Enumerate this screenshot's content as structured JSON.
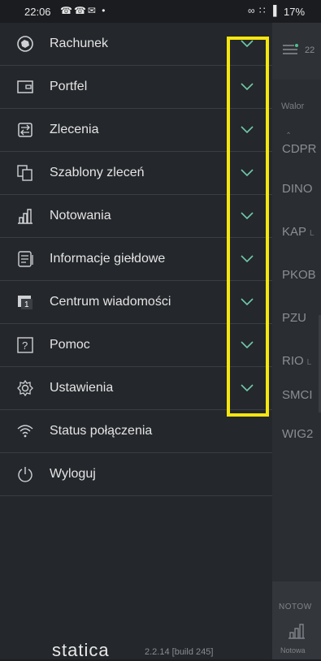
{
  "status_bar": {
    "time": "22:06",
    "battery": "17%"
  },
  "menu": [
    {
      "label": "Rachunek",
      "icon": "account-icon",
      "expandable": true
    },
    {
      "label": "Portfel",
      "icon": "wallet-icon",
      "expandable": true
    },
    {
      "label": "Zlecenia",
      "icon": "orders-icon",
      "expandable": true
    },
    {
      "label": "Szablony zleceń",
      "icon": "templates-icon",
      "expandable": true
    },
    {
      "label": "Notowania",
      "icon": "quotes-icon",
      "expandable": true
    },
    {
      "label": "Informacje giełdowe",
      "icon": "exchange-info-icon",
      "expandable": true
    },
    {
      "label": "Centrum wiadomości",
      "icon": "message-center-icon",
      "expandable": true
    },
    {
      "label": "Pomoc",
      "icon": "help-icon",
      "expandable": true
    },
    {
      "label": "Ustawienia",
      "icon": "settings-icon",
      "expandable": true
    },
    {
      "label": "Status połączenia",
      "icon": "wifi-icon",
      "expandable": false
    },
    {
      "label": "Wyloguj",
      "icon": "power-icon",
      "expandable": false
    }
  ],
  "background": {
    "clock": "22",
    "column_header": "Walor",
    "rows": [
      {
        "name": "CDPR",
        "suffix": ""
      },
      {
        "name": "DINO",
        "suffix": ""
      },
      {
        "name": "KAP",
        "suffix": "L"
      },
      {
        "name": "PKOB",
        "suffix": ""
      },
      {
        "name": "PZU",
        "suffix": ""
      },
      {
        "name": "RIO",
        "suffix": "L"
      },
      {
        "name": "SMCI",
        "suffix": ""
      },
      {
        "name": "WIG2",
        "suffix": ""
      }
    ],
    "bottom_section": "NOTOW",
    "bottom_nav": "Notowa"
  },
  "footer": {
    "logo": "statica",
    "version": "2.2.14 [build 245]"
  },
  "colors": {
    "highlight": "#f5e60f",
    "drawer": "#24272b"
  }
}
